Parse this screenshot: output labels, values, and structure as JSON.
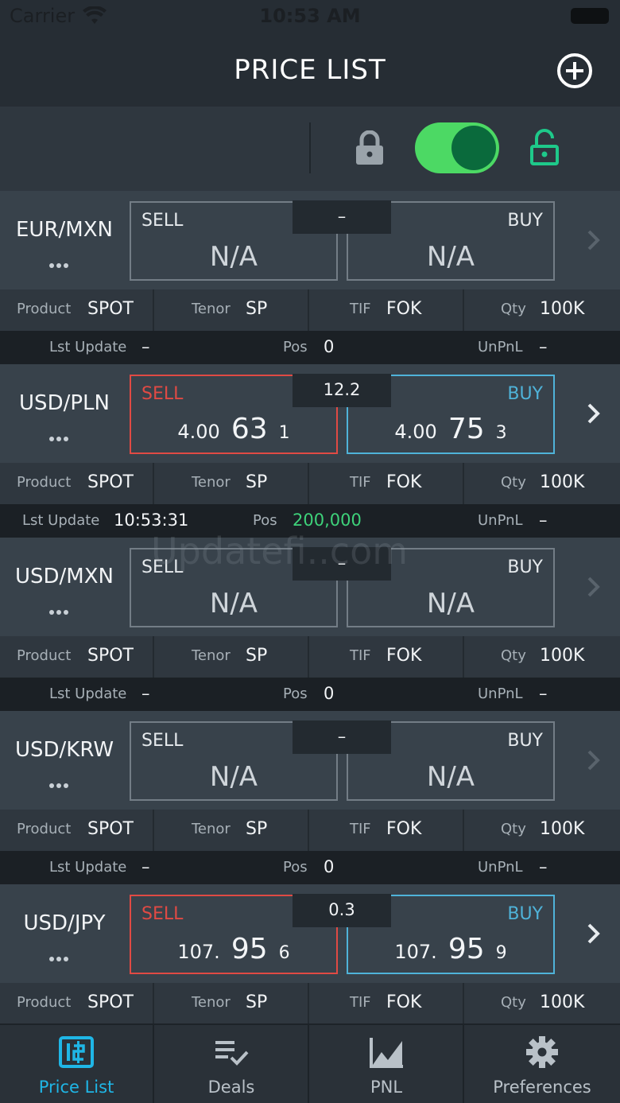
{
  "status_bar": {
    "carrier": "Carrier",
    "time": "10:53 AM"
  },
  "nav": {
    "title": "PRICE LIST"
  },
  "colors": {
    "sell": "#e04a44",
    "buy": "#4fb3d9",
    "toggle_on": "#4cd964",
    "positive": "#3ed27a",
    "active_tab": "#1fb6e6"
  },
  "lock_bar": {
    "toggle_on": true
  },
  "currencies": [
    {
      "pair": "EUR/MXN",
      "spread": "–",
      "sell": {
        "label": "SELL",
        "na": "N/A"
      },
      "buy": {
        "label": "BUY",
        "na": "N/A"
      },
      "info": {
        "product_key": "Product",
        "product": "SPOT",
        "tenor_key": "Tenor",
        "tenor": "SP",
        "tif_key": "TIF",
        "tif": "FOK",
        "qty_key": "Qty",
        "qty": "100K"
      },
      "update": {
        "lst_key": "Lst Update",
        "lst": "–",
        "pos_key": "Pos",
        "pos": "0",
        "unpnl_key": "UnPnL",
        "unpnl": "–"
      }
    },
    {
      "pair": "USD/PLN",
      "spread": "12.2",
      "sell": {
        "label": "SELL",
        "big": "4.00",
        "pips": "63",
        "frac": "1"
      },
      "buy": {
        "label": "BUY",
        "big": "4.00",
        "pips": "75",
        "frac": "3"
      },
      "info": {
        "product_key": "Product",
        "product": "SPOT",
        "tenor_key": "Tenor",
        "tenor": "SP",
        "tif_key": "TIF",
        "tif": "FOK",
        "qty_key": "Qty",
        "qty": "100K"
      },
      "update": {
        "lst_key": "Lst Update",
        "lst": "10:53:31",
        "pos_key": "Pos",
        "pos": "200,000",
        "unpnl_key": "UnPnL",
        "unpnl": "–"
      }
    },
    {
      "pair": "USD/MXN",
      "spread": "–",
      "sell": {
        "label": "SELL",
        "na": "N/A"
      },
      "buy": {
        "label": "BUY",
        "na": "N/A"
      },
      "info": {
        "product_key": "Product",
        "product": "SPOT",
        "tenor_key": "Tenor",
        "tenor": "SP",
        "tif_key": "TIF",
        "tif": "FOK",
        "qty_key": "Qty",
        "qty": "100K"
      },
      "update": {
        "lst_key": "Lst Update",
        "lst": "–",
        "pos_key": "Pos",
        "pos": "0",
        "unpnl_key": "UnPnL",
        "unpnl": "–"
      }
    },
    {
      "pair": "USD/KRW",
      "spread": "–",
      "sell": {
        "label": "SELL",
        "na": "N/A"
      },
      "buy": {
        "label": "BUY",
        "na": "N/A"
      },
      "info": {
        "product_key": "Product",
        "product": "SPOT",
        "tenor_key": "Tenor",
        "tenor": "SP",
        "tif_key": "TIF",
        "tif": "FOK",
        "qty_key": "Qty",
        "qty": "100K"
      },
      "update": {
        "lst_key": "Lst Update",
        "lst": "–",
        "pos_key": "Pos",
        "pos": "0",
        "unpnl_key": "UnPnL",
        "unpnl": "–"
      }
    },
    {
      "pair": "USD/JPY",
      "spread": "0.3",
      "sell": {
        "label": "SELL",
        "big": "107.",
        "pips": "95",
        "frac": "6"
      },
      "buy": {
        "label": "BUY",
        "big": "107.",
        "pips": "95",
        "frac": "9"
      },
      "info": {
        "product_key": "Product",
        "product": "SPOT",
        "tenor_key": "Tenor",
        "tenor": "SP",
        "tif_key": "TIF",
        "tif": "FOK",
        "qty_key": "Qty",
        "qty": "100K"
      }
    }
  ],
  "watermark": "Updatefi..com",
  "tabs": [
    {
      "label": "Price List",
      "icon": "price-list-icon",
      "active": true
    },
    {
      "label": "Deals",
      "icon": "deals-icon"
    },
    {
      "label": "PNL",
      "icon": "pnl-chart-icon"
    },
    {
      "label": "Preferences",
      "icon": "gear-icon"
    }
  ]
}
